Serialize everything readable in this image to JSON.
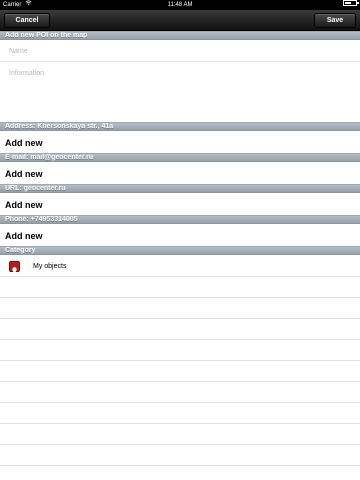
{
  "status_bar": {
    "carrier": "Carrier",
    "time": "11:48 AM",
    "wifi_icon": "wifi-icon",
    "battery_icon": "battery-icon"
  },
  "nav": {
    "cancel_label": "Cancel",
    "save_label": "Save"
  },
  "poi_section": {
    "header": "Add new POI on the map",
    "name_placeholder": "Name",
    "info_placeholder": "Information"
  },
  "address_section": {
    "header": "Address: Khersonskaya str., 41a",
    "add_label": "Add new"
  },
  "email_section": {
    "header": "E-mail: mail@geocenter.ru",
    "add_label": "Add new"
  },
  "url_section": {
    "header": "URL: geocenter.ru",
    "add_label": "Add new"
  },
  "phone_section": {
    "header": "Phone: +74953314005",
    "add_label": "Add new"
  },
  "category_section": {
    "header": "Category",
    "items": [
      {
        "label": "My objects",
        "icon": "category-icon",
        "color": "#b41e1e"
      }
    ]
  },
  "colors": {
    "nav_bar": "#222222",
    "section_header": "#a5aeb7"
  }
}
